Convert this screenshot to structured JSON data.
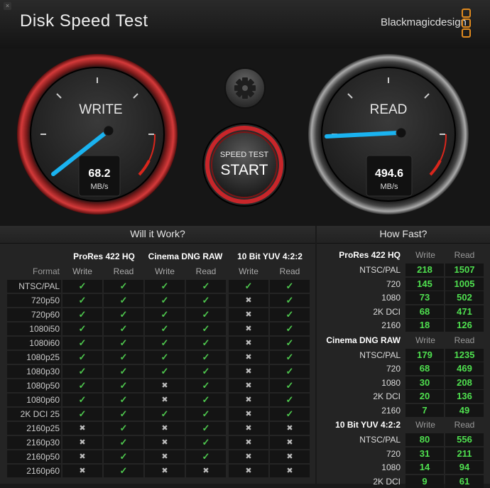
{
  "window": {
    "close_glyph": "×",
    "title": "Disk Speed Test",
    "brand": "Blackmagicdesign"
  },
  "write_gauge": {
    "label": "WRITE",
    "value": "68.2",
    "unit": "MB/s"
  },
  "read_gauge": {
    "label": "READ",
    "value": "494.6",
    "unit": "MB/s"
  },
  "start_button": {
    "top_label": "SPEED TEST",
    "main_label": "START"
  },
  "will_it_work": {
    "heading": "Will it Work?",
    "format_header": "Format",
    "groups": [
      {
        "name": "ProRes 422 HQ",
        "write": "Write",
        "read": "Read"
      },
      {
        "name": "Cinema DNG RAW",
        "write": "Write",
        "read": "Read"
      },
      {
        "name": "10 Bit YUV 4:2:2",
        "write": "Write",
        "read": "Read"
      }
    ],
    "rows": [
      {
        "format": "NTSC/PAL",
        "marks": [
          1,
          1,
          1,
          1,
          1,
          1
        ]
      },
      {
        "format": "720p50",
        "marks": [
          1,
          1,
          1,
          1,
          0,
          1
        ]
      },
      {
        "format": "720p60",
        "marks": [
          1,
          1,
          1,
          1,
          0,
          1
        ]
      },
      {
        "format": "1080i50",
        "marks": [
          1,
          1,
          1,
          1,
          0,
          1
        ]
      },
      {
        "format": "1080i60",
        "marks": [
          1,
          1,
          1,
          1,
          0,
          1
        ]
      },
      {
        "format": "1080p25",
        "marks": [
          1,
          1,
          1,
          1,
          0,
          1
        ]
      },
      {
        "format": "1080p30",
        "marks": [
          1,
          1,
          1,
          1,
          0,
          1
        ]
      },
      {
        "format": "1080p50",
        "marks": [
          1,
          1,
          0,
          1,
          0,
          1
        ]
      },
      {
        "format": "1080p60",
        "marks": [
          1,
          1,
          0,
          1,
          0,
          1
        ]
      },
      {
        "format": "2K DCI 25",
        "marks": [
          1,
          1,
          1,
          1,
          0,
          1
        ]
      },
      {
        "format": "2160p25",
        "marks": [
          0,
          1,
          0,
          1,
          0,
          0
        ]
      },
      {
        "format": "2160p30",
        "marks": [
          0,
          1,
          0,
          1,
          0,
          0
        ]
      },
      {
        "format": "2160p50",
        "marks": [
          0,
          1,
          0,
          1,
          0,
          0
        ]
      },
      {
        "format": "2160p60",
        "marks": [
          0,
          1,
          0,
          0,
          0,
          0
        ]
      }
    ],
    "check_glyph": "✓",
    "cross_glyph": "✖"
  },
  "how_fast": {
    "heading": "How Fast?",
    "write": "Write",
    "read": "Read",
    "groups": [
      {
        "name": "ProRes 422 HQ",
        "rows": [
          {
            "label": "NTSC/PAL",
            "write": "218",
            "read": "1507"
          },
          {
            "label": "720",
            "write": "145",
            "read": "1005"
          },
          {
            "label": "1080",
            "write": "73",
            "read": "502"
          },
          {
            "label": "2K DCI",
            "write": "68",
            "read": "471"
          },
          {
            "label": "2160",
            "write": "18",
            "read": "126"
          }
        ]
      },
      {
        "name": "Cinema DNG RAW",
        "rows": [
          {
            "label": "NTSC/PAL",
            "write": "179",
            "read": "1235"
          },
          {
            "label": "720",
            "write": "68",
            "read": "469"
          },
          {
            "label": "1080",
            "write": "30",
            "read": "208"
          },
          {
            "label": "2K DCI",
            "write": "20",
            "read": "136"
          },
          {
            "label": "2160",
            "write": "7",
            "read": "49"
          }
        ]
      },
      {
        "name": "10 Bit YUV 4:2:2",
        "rows": [
          {
            "label": "NTSC/PAL",
            "write": "80",
            "read": "556"
          },
          {
            "label": "720",
            "write": "31",
            "read": "211"
          },
          {
            "label": "1080",
            "write": "14",
            "read": "94"
          },
          {
            "label": "2K DCI",
            "write": "9",
            "read": "61"
          }
        ]
      }
    ]
  },
  "colors": {
    "accent_red": "#c8262a",
    "needle_blue": "#1ab3f0",
    "ok_green": "#4ec84e",
    "logo_orange": "#e08a1e"
  }
}
